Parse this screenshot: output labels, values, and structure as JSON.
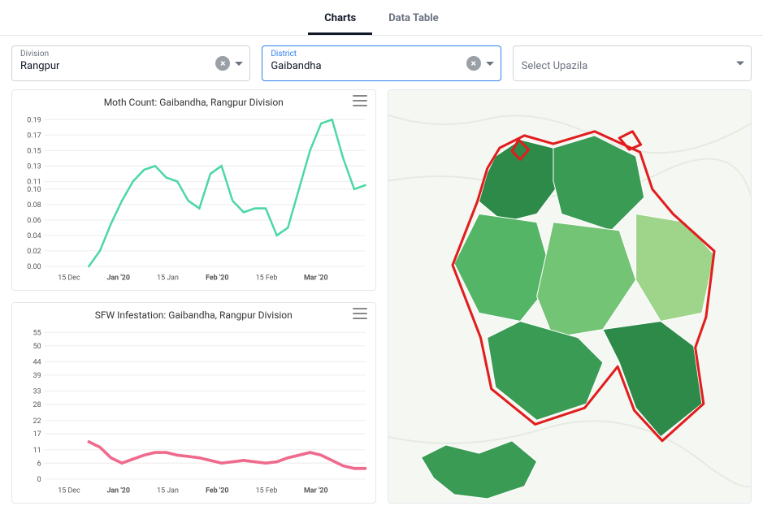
{
  "tabs": {
    "charts": "Charts",
    "dataTable": "Data Table",
    "active": "charts"
  },
  "filters": {
    "division": {
      "label": "Division",
      "value": "Rangpur"
    },
    "district": {
      "label": "District",
      "value": "Gaibandha"
    },
    "upazila": {
      "placeholder": "Select Upazila"
    }
  },
  "chart1": {
    "title": "Moth Count: Gaibandha, Rangpur Division",
    "yTicks": [
      0,
      0.02,
      0.04,
      0.06,
      0.08,
      0.1,
      0.11,
      0.13,
      0.15,
      0.17,
      0.19
    ],
    "xTicks": [
      {
        "label": "15 Dec",
        "bold": false
      },
      {
        "label": "Jan '20",
        "bold": true
      },
      {
        "label": "15 Jan",
        "bold": false
      },
      {
        "label": "Feb '20",
        "bold": true
      },
      {
        "label": "15 Feb",
        "bold": false
      },
      {
        "label": "Mar '20",
        "bold": true
      }
    ]
  },
  "chart2": {
    "title": "SFW Infestation: Gaibandha, Rangpur Division",
    "yTicks": [
      0,
      6,
      11,
      17,
      22,
      28,
      33,
      39,
      44,
      50,
      55
    ],
    "xTicks": [
      {
        "label": "15 Dec",
        "bold": false
      },
      {
        "label": "Jan '20",
        "bold": true
      },
      {
        "label": "15 Jan",
        "bold": false
      },
      {
        "label": "Feb '20",
        "bold": true
      },
      {
        "label": "15 Feb",
        "bold": false
      },
      {
        "label": "Mar '20",
        "bold": true
      }
    ]
  },
  "colors": {
    "series1": "#4dd7a5",
    "series2": "#ef6b8e",
    "mapBorder": "#e11d1d"
  },
  "map_palette": [
    "#9ed58b",
    "#74c476",
    "#55b567",
    "#3a9b54",
    "#2d8a48"
  ],
  "chart_data": [
    {
      "id": "moth_count",
      "type": "line",
      "title": "Moth Count: Gaibandha, Rangpur Division",
      "xlabel": "",
      "ylabel": "",
      "ylim": [
        0,
        0.19
      ],
      "x_dates": [
        "2019-12-28",
        "2019-12-31",
        "2020-01-03",
        "2020-01-06",
        "2020-01-09",
        "2020-01-12",
        "2020-01-15",
        "2020-01-18",
        "2020-01-21",
        "2020-01-24",
        "2020-01-27",
        "2020-01-30",
        "2020-02-02",
        "2020-02-05",
        "2020-02-08",
        "2020-02-11",
        "2020-02-14",
        "2020-02-17",
        "2020-02-20",
        "2020-02-23",
        "2020-02-26",
        "2020-02-29",
        "2020-03-03",
        "2020-03-07",
        "2020-03-11",
        "2020-03-15"
      ],
      "values": [
        0,
        0.02,
        0.055,
        0.085,
        0.11,
        0.125,
        0.13,
        0.115,
        0.11,
        0.085,
        0.075,
        0.12,
        0.13,
        0.085,
        0.07,
        0.075,
        0.075,
        0.04,
        0.05,
        0.1,
        0.15,
        0.185,
        0.19,
        0.14,
        0.1,
        0.105
      ],
      "series": [
        {
          "name": "Moth count",
          "color": "#4dd7a5"
        }
      ]
    },
    {
      "id": "sfw_infestation",
      "type": "line",
      "title": "SFW Infestation: Gaibandha, Rangpur Division",
      "xlabel": "",
      "ylabel": "",
      "ylim": [
        0,
        55
      ],
      "x_dates": [
        "2019-12-28",
        "2019-12-31",
        "2020-01-03",
        "2020-01-06",
        "2020-01-09",
        "2020-01-12",
        "2020-01-15",
        "2020-01-18",
        "2020-01-21",
        "2020-01-24",
        "2020-01-27",
        "2020-01-30",
        "2020-02-02",
        "2020-02-05",
        "2020-02-08",
        "2020-02-11",
        "2020-02-14",
        "2020-02-17",
        "2020-02-20",
        "2020-02-23",
        "2020-02-26",
        "2020-02-29",
        "2020-03-03",
        "2020-03-07",
        "2020-03-11",
        "2020-03-15"
      ],
      "values": [
        14,
        12,
        8,
        6,
        7.5,
        9,
        10,
        10,
        9,
        8.5,
        8,
        7,
        6,
        6.5,
        7,
        6.5,
        6,
        6.5,
        8,
        9,
        10,
        9,
        7,
        5,
        4,
        4
      ],
      "series": [
        {
          "name": "SFW infestation",
          "color": "#ef6b8e"
        }
      ]
    }
  ]
}
